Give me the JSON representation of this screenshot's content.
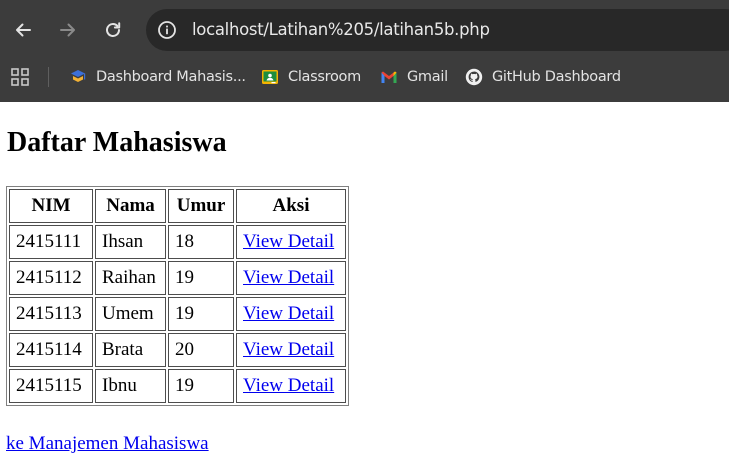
{
  "browser": {
    "url": "localhost/Latihan%205/latihan5b.php",
    "bookmarks": [
      {
        "label": "Dashboard Mahasis...",
        "icon": "dashboard-favicon-icon"
      },
      {
        "label": "Classroom",
        "icon": "classroom-icon",
        "color": "#f4b400"
      },
      {
        "label": "Gmail",
        "icon": "gmail-icon"
      },
      {
        "label": "GitHub Dashboard",
        "icon": "github-icon"
      }
    ]
  },
  "page": {
    "title": "Daftar Mahasiswa",
    "table": {
      "headers": [
        "NIM",
        "Nama",
        "Umur",
        "Aksi"
      ],
      "rows": [
        {
          "nim": "2415111",
          "nama": "Ihsan",
          "umur": "18",
          "aksi": "View Detail"
        },
        {
          "nim": "2415112",
          "nama": "Raihan",
          "umur": "19",
          "aksi": "View Detail"
        },
        {
          "nim": "2415113",
          "nama": "Umem",
          "umur": "19",
          "aksi": "View Detail"
        },
        {
          "nim": "2415114",
          "nama": "Brata",
          "umur": "20",
          "aksi": "View Detail"
        },
        {
          "nim": "2415115",
          "nama": "Ibnu",
          "umur": "19",
          "aksi": "View Detail"
        }
      ]
    },
    "bottom_link": "ke Manajemen Mahasiswa"
  },
  "colors": {
    "chrome_bg": "#3c3c3c",
    "omnibox_bg": "#282828",
    "link": "#0000ee"
  }
}
